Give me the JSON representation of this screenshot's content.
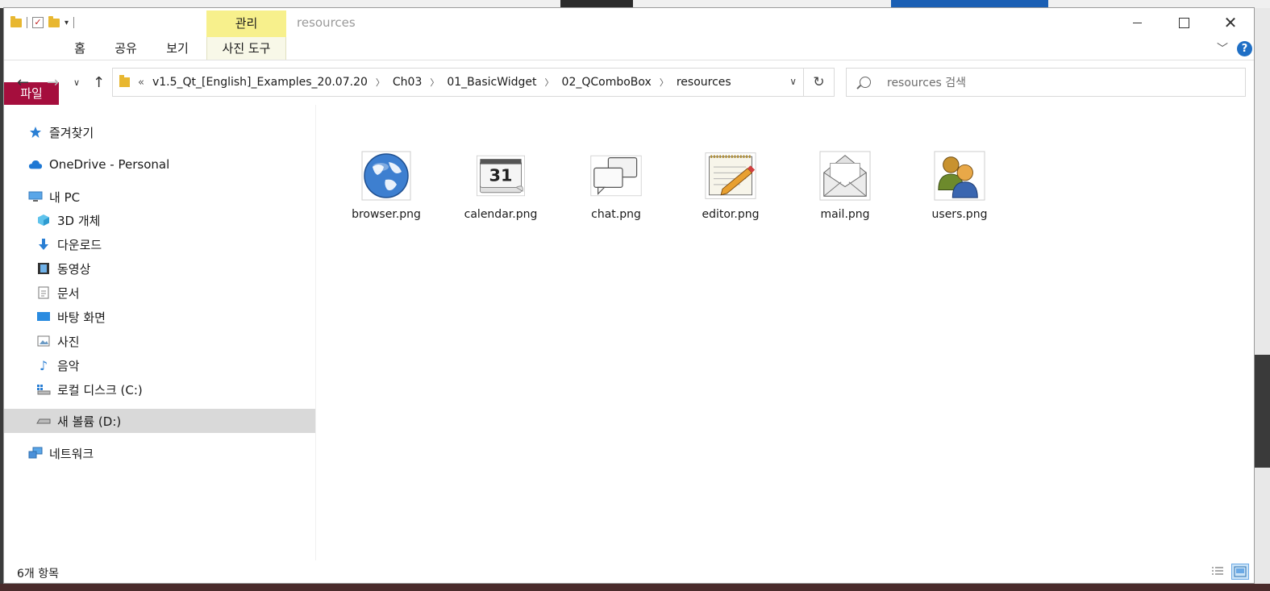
{
  "window": {
    "title": "resources",
    "contextual_tab_group": "관리"
  },
  "ribbon": {
    "tabs": [
      {
        "label": "파일"
      },
      {
        "label": "홈"
      },
      {
        "label": "공유"
      },
      {
        "label": "보기"
      },
      {
        "label": "사진 도구"
      }
    ],
    "help_label": "?"
  },
  "address": {
    "overflow": "«",
    "crumbs": [
      "v1.5_Qt_[English]_Examples_20.07.20",
      "Ch03",
      "01_BasicWidget",
      "02_QComboBox",
      "resources"
    ]
  },
  "search": {
    "placeholder": "resources 검색"
  },
  "sidebar": {
    "items": [
      {
        "label": "즐겨찾기",
        "icon": "star-icon"
      },
      {
        "label": "OneDrive - Personal",
        "icon": "cloud-icon"
      },
      {
        "label": "내 PC",
        "icon": "pc-icon"
      },
      {
        "label": "3D 개체",
        "icon": "cube-icon"
      },
      {
        "label": "다운로드",
        "icon": "download-icon"
      },
      {
        "label": "동영상",
        "icon": "video-icon"
      },
      {
        "label": "문서",
        "icon": "document-icon"
      },
      {
        "label": "바탕 화면",
        "icon": "desktop-icon"
      },
      {
        "label": "사진",
        "icon": "picture-icon"
      },
      {
        "label": "음악",
        "icon": "music-icon"
      },
      {
        "label": "로컬 디스크 (C:)",
        "icon": "drive-c-icon"
      },
      {
        "label": "새 볼륨 (D:)",
        "icon": "drive-icon"
      },
      {
        "label": "네트워크",
        "icon": "network-icon"
      }
    ],
    "selected": "새 볼륨 (D:)"
  },
  "files": [
    {
      "name": "browser.png",
      "icon": "globe-icon"
    },
    {
      "name": "calendar.png",
      "icon": "calendar-icon",
      "day": "31"
    },
    {
      "name": "chat.png",
      "icon": "chat-icon"
    },
    {
      "name": "editor.png",
      "icon": "notepad-icon"
    },
    {
      "name": "mail.png",
      "icon": "envelope-icon"
    },
    {
      "name": "users.png",
      "icon": "users-icon"
    }
  ],
  "status": {
    "item_count": "6개 항목"
  },
  "colors": {
    "file_tab": "#a50e3d",
    "contextual_tab": "#f7f08c",
    "selection": "#d9d9d9",
    "help": "#1f6fc5"
  }
}
